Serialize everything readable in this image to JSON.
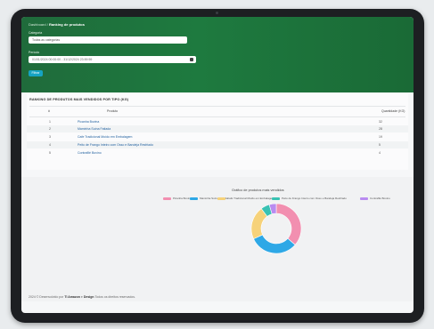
{
  "breadcrumb": {
    "home": "Dashboard",
    "separator": "/",
    "current": "Ranking de produtos"
  },
  "filters": {
    "category_label": "Categoria",
    "category_value": "Todas as categorias",
    "period_label": "Período",
    "period_value": "01/01/2024 00:00:00 - 31/12/2024 23:59:59",
    "filter_button": "Filtrar"
  },
  "table": {
    "title": "RANKING DE PRODUTOS MAIS VENDIDOS POR TIPO (KG)",
    "headers": [
      "#",
      "Produto",
      "Quantidade (KG)"
    ],
    "rows": [
      {
        "rank": "1",
        "product": "Picanha Bovina",
        "qty": "32"
      },
      {
        "rank": "2",
        "product": "Maminha Suína Fatiada",
        "qty": "28"
      },
      {
        "rank": "3",
        "product": "Cafe Tradicional Moído em Embalagem",
        "qty": "19"
      },
      {
        "rank": "4",
        "product": "Peito de Frango Inteiro com Osso e Bandeja Resfriado",
        "qty": "5"
      },
      {
        "rank": "5",
        "product": "Contrafilé Bovino",
        "qty": "4"
      }
    ]
  },
  "chart_data": {
    "type": "pie",
    "title": "Gráfico de produtos mais vendidos",
    "categories": [
      "Picanha Bovina",
      "Maminha Suína Fatiada",
      "Café Tradicional Moído em Embalagem",
      "Peito de Frango Inteiro com Osso e Bandeja Resfriado",
      "Contrafilé Bovino"
    ],
    "values": [
      32,
      28,
      19,
      5,
      4
    ],
    "colors": [
      "#f28fb0",
      "#2ea8e6",
      "#f6d27a",
      "#39c2b3",
      "#b98bf0"
    ],
    "legend_position": "top"
  },
  "footer": {
    "prefix": "2024 © Desenvolvido por",
    "brand1": "TI Amazon",
    "mid": "e",
    "brand2": "Design",
    "suffix": "Todos os direitos reservados."
  }
}
